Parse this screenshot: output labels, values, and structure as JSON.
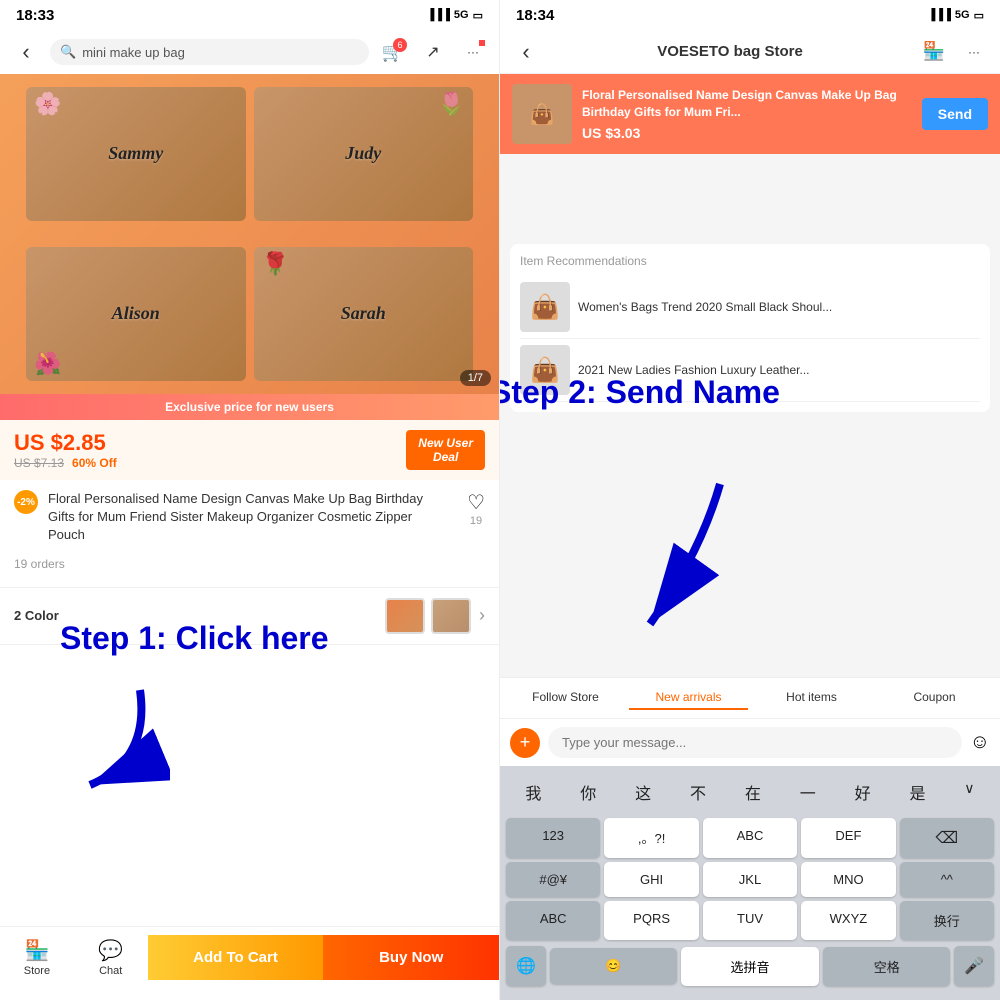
{
  "left": {
    "status_time": "18:33",
    "signal": "5G",
    "search_placeholder": "mini make up bag",
    "product_image_bags": [
      {
        "name": "Sammy"
      },
      {
        "name": "Judy"
      },
      {
        "name": "Alison"
      },
      {
        "name": "Sarah"
      }
    ],
    "image_counter": "1/7",
    "exclusive_banner": "Exclusive price for new users",
    "current_price": "US $2.85",
    "original_price": "US $7.13",
    "discount_pct": "60% Off",
    "new_user_label": "New User Deal",
    "discount_badge": "-2%",
    "product_title": "Floral Personalised Name Design Canvas Make Up Bag Birthday Gifts for Mum Friend Sister Makeup Organizer Cosmetic Zipper Pouch",
    "like_count": "19",
    "orders_count": "19 orders",
    "color_label": "2 Color",
    "step1_text": "Step 1: Click here",
    "add_to_cart": "Add To Cart",
    "buy_now": "Buy Now",
    "nav_store": "Store",
    "nav_chat": "Chat"
  },
  "right": {
    "status_time": "18:34",
    "signal": "5G",
    "store_name": "VOESETO bag Store",
    "banner_title": "Floral Personalised Name Design Canvas Make Up Bag Birthday Gifts for Mum Fri...",
    "banner_price": "US $3.03",
    "send_btn": "Send",
    "step2_text": "Step 2: Send Name",
    "rec_title": "Item Recommendations",
    "rec_items": [
      {
        "name": "Women's Bags Trend 2020 Small Black Shoul..."
      },
      {
        "name": "2021 New Ladies Fashion Luxury Leather..."
      }
    ],
    "tabs": [
      "Follow Store",
      "New arrivals",
      "Hot items",
      "Coupon"
    ],
    "message_placeholder": "Type your message...",
    "quick_chars": [
      "我",
      "你",
      "这",
      "不",
      "在",
      "一",
      "好",
      "是"
    ],
    "keyboard_rows": [
      [
        "123",
        ",。?!",
        "ABC",
        "DEF",
        "⌫"
      ],
      [
        "#@¥",
        "GHI",
        "JKL",
        "MNO",
        "^^"
      ],
      [
        "ABC",
        "PQRS",
        "TUV",
        "WXYZ",
        "换行"
      ],
      [
        "😊",
        "选拼音",
        "空格"
      ]
    ],
    "globe_icon": "🌐",
    "mic_icon": "🎤"
  },
  "icons": {
    "back_arrow": "‹",
    "search_icon": "🔍",
    "cart_icon": "🛒",
    "share_icon": "↗",
    "more_icon": "···",
    "store_icon": "🏪",
    "store_nav_icon": "🏠",
    "chat_icon": "💬",
    "chevron_right": "›",
    "heart_icon": "♡",
    "smile_icon": "☺",
    "plus_icon": "+"
  }
}
